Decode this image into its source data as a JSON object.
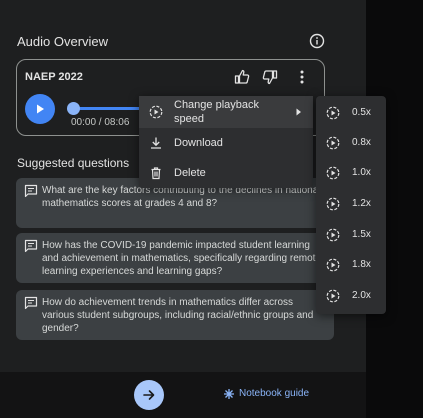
{
  "audio_overview": {
    "title": "Audio Overview",
    "card_title": "NAEP 2022",
    "time": "00:00 / 08:06",
    "progress": 0.0
  },
  "suggested": {
    "title": "Suggested questions",
    "questions": [
      "What are the key factors contributing to the declines in national mathematics scores at grades 4 and 8?",
      "How has the COVID-19 pandemic impacted student learning and achievement in mathematics, specifically regarding remote learning experiences and learning gaps?",
      "How do achievement trends in mathematics differ across various student subgroups, including racial/ethnic groups and gender?"
    ]
  },
  "menu": {
    "items": [
      {
        "label": "Change playback speed",
        "icon": "speed-icon"
      },
      {
        "label": "Download",
        "icon": "download-icon"
      },
      {
        "label": "Delete",
        "icon": "trash-icon"
      }
    ],
    "speeds": [
      "0.5x",
      "0.8x",
      "1.0x",
      "1.2x",
      "1.5x",
      "1.8x",
      "2.0x"
    ]
  },
  "footer": {
    "guide_label": "Notebook guide"
  },
  "colors": {
    "accent": "#4285f4",
    "link": "#8ab4f8",
    "send": "#a8c7fa"
  }
}
